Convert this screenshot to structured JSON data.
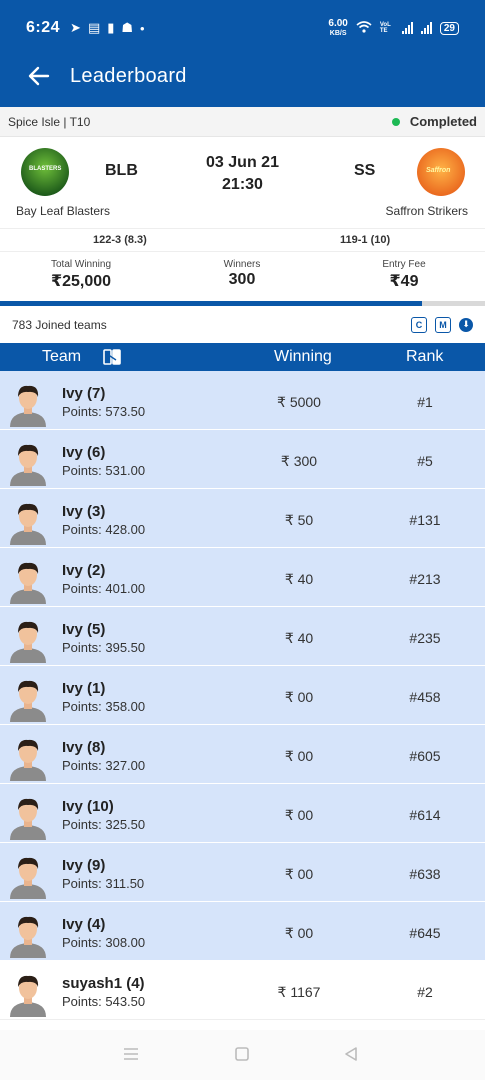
{
  "status_bar": {
    "time": "6:24",
    "net_speed": "6.00",
    "net_unit": "KB/S",
    "lte": "VoLTE",
    "battery": "29"
  },
  "app_bar": {
    "title": "Leaderboard"
  },
  "match": {
    "series": "Spice Isle | T10",
    "status": "Completed",
    "team1_abbr": "BLB",
    "team1_name": "Bay Leaf Blasters",
    "team1_score": "122-3 (8.3)",
    "team2_abbr": "SS",
    "team2_name": "Saffron Strikers",
    "team2_score": "119-1 (10)",
    "date": "03 Jun 21",
    "time": "21:30",
    "team1_logo_text": "BLASTERS",
    "team2_logo_text": "Saffron"
  },
  "prize": {
    "total_label": "Total Winning",
    "total_value": "₹25,000",
    "winners_label": "Winners",
    "winners_value": "300",
    "fee_label": "Entry Fee",
    "fee_value": "₹49",
    "fill_fraction": 0.87
  },
  "joined": {
    "text": "783 Joined teams",
    "btn_c": "C",
    "btn_m": "M",
    "btn_dl": "⬇"
  },
  "table": {
    "col_team": "Team",
    "col_winning": "Winning",
    "col_rank": "Rank",
    "rows": [
      {
        "name": "Ivy (7)",
        "points": "Points: 573.50",
        "winning": "₹ 5000",
        "rank": "#1",
        "highlight": true
      },
      {
        "name": "Ivy (6)",
        "points": "Points: 531.00",
        "winning": "₹ 300",
        "rank": "#5",
        "highlight": true
      },
      {
        "name": "Ivy (3)",
        "points": "Points: 428.00",
        "winning": "₹ 50",
        "rank": "#131",
        "highlight": true
      },
      {
        "name": "Ivy (2)",
        "points": "Points: 401.00",
        "winning": "₹ 40",
        "rank": "#213",
        "highlight": true
      },
      {
        "name": "Ivy (5)",
        "points": "Points: 395.50",
        "winning": "₹ 40",
        "rank": "#235",
        "highlight": true
      },
      {
        "name": "Ivy (1)",
        "points": "Points: 358.00",
        "winning": "₹ 00",
        "rank": "#458",
        "highlight": true
      },
      {
        "name": "Ivy (8)",
        "points": "Points: 327.00",
        "winning": "₹ 00",
        "rank": "#605",
        "highlight": true
      },
      {
        "name": "Ivy (10)",
        "points": "Points: 325.50",
        "winning": "₹ 00",
        "rank": "#614",
        "highlight": true
      },
      {
        "name": "Ivy (9)",
        "points": "Points: 311.50",
        "winning": "₹ 00",
        "rank": "#638",
        "highlight": true
      },
      {
        "name": "Ivy (4)",
        "points": "Points: 308.00",
        "winning": "₹ 00",
        "rank": "#645",
        "highlight": true
      },
      {
        "name": "suyash1 (4)",
        "points": "Points: 543.50",
        "winning": "₹ 1167",
        "rank": "#2",
        "highlight": false
      }
    ]
  },
  "colors": {
    "primary": "#0a57a8",
    "row_highlight": "#d6e4fa",
    "status_green": "#1db954"
  }
}
